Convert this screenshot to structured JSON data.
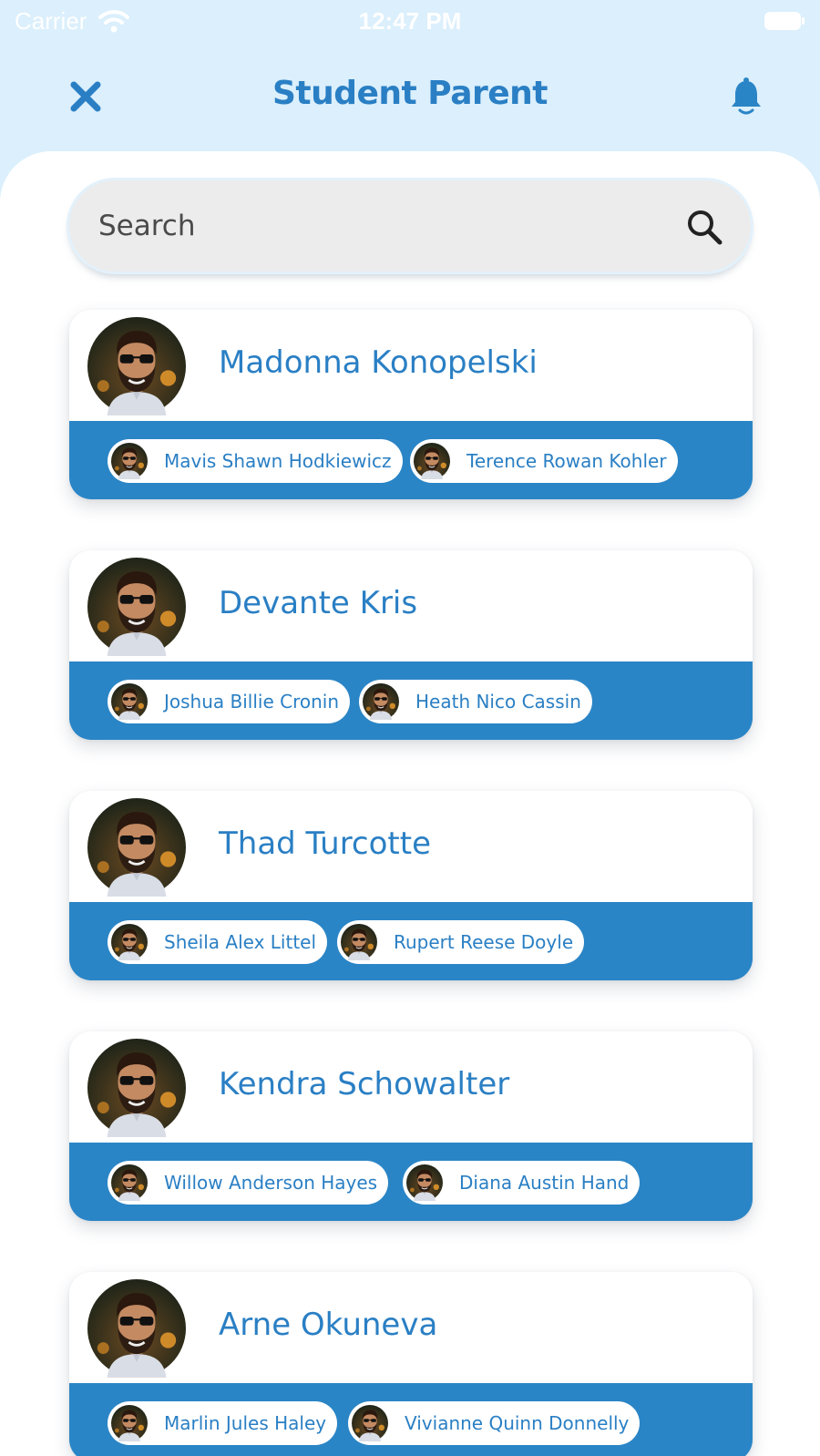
{
  "status_bar": {
    "carrier": "Carrier",
    "time": "12:47 PM",
    "icons": [
      "wifi-icon",
      "battery-icon"
    ]
  },
  "header": {
    "title": "Student Parent",
    "left_icon": "close-icon",
    "right_icon": "bell-icon"
  },
  "search": {
    "placeholder": "Search",
    "icon": "search-icon"
  },
  "colors": {
    "accent": "#2a7fc4",
    "band": "#2a85c6",
    "header_bg": "#dbeffc",
    "search_bg": "#ececec"
  },
  "parents": [
    {
      "name": "Madonna Konopelski",
      "students": [
        "Mavis Shawn Hodkiewicz",
        "Terence Rowan Kohler"
      ]
    },
    {
      "name": "Devante Kris",
      "students": [
        "Joshua Billie Cronin",
        "Heath Nico Cassin"
      ]
    },
    {
      "name": "Thad Turcotte",
      "students": [
        "Sheila Alex Littel",
        "Rupert Reese Doyle"
      ]
    },
    {
      "name": "Kendra Schowalter",
      "students": [
        "Willow Anderson Hayes",
        "Diana Austin Hand"
      ]
    },
    {
      "name": "Arne Okuneva",
      "students": [
        "Marlin Jules Haley",
        "Vivianne Quinn Donnelly"
      ]
    }
  ]
}
